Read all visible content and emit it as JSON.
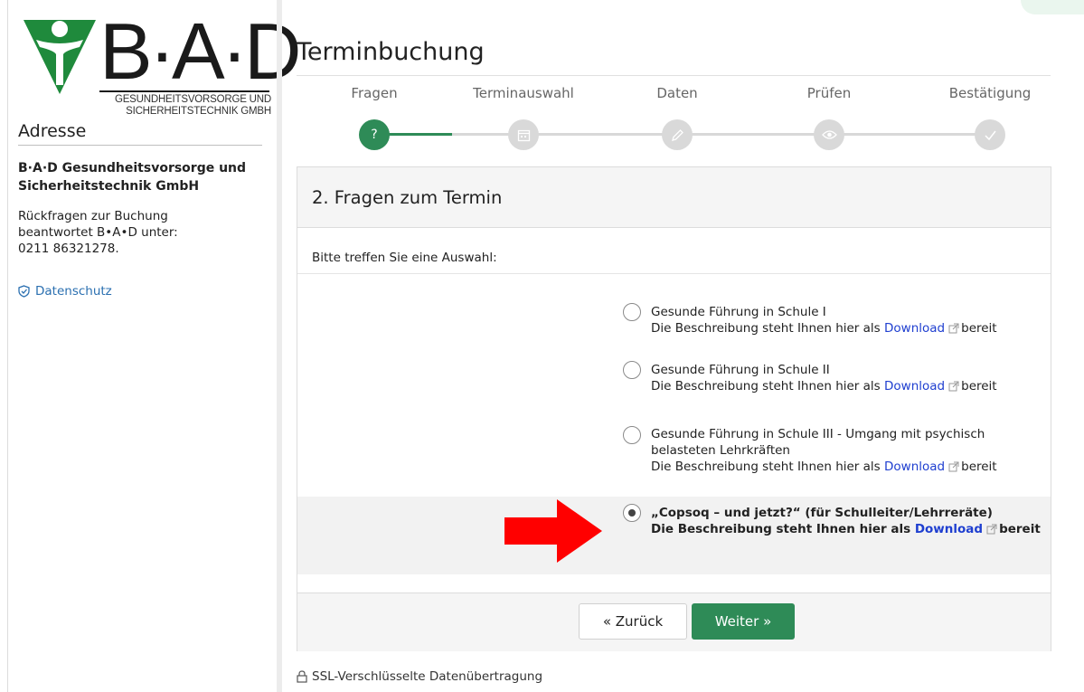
{
  "brand": {
    "logo_text": "B·A·D",
    "logo_sub_line1": "GESUNDHEITSVORSORGE UND",
    "logo_sub_line2": "SICHERHEITSTECHNIK GMBH",
    "green": "#2e8b57",
    "logo_green": "#1f8a3c"
  },
  "sidebar": {
    "heading": "Adresse",
    "company": "B·A·D Gesundheitsvorsorge und Sicherheitstechnik GmbH",
    "info_line1": "Rückfragen zur Buchung",
    "info_line2": "beantwortet B•A•D unter:",
    "info_line3": "0211 86321278.",
    "privacy_icon": "shield-check-icon",
    "privacy_label": "Datenschutz"
  },
  "main": {
    "title": "Terminbuchung",
    "steps": [
      {
        "label": "Fragen",
        "icon": "?",
        "active": true
      },
      {
        "label": "Terminauswahl",
        "icon": "calendar-icon",
        "active": false
      },
      {
        "label": "Daten",
        "icon": "pencil-icon",
        "active": false
      },
      {
        "label": "Prüfen",
        "icon": "eye-icon",
        "active": false
      },
      {
        "label": "Bestätigung",
        "icon": "check-icon",
        "active": false
      }
    ],
    "panel_title": "2. Fragen zum Termin",
    "prompt": "Bitte treffen Sie eine Auswahl:",
    "options": [
      {
        "title": "Gesunde Führung in Schule I",
        "desc_prefix": "Die Beschreibung steht Ihnen hier als",
        "link": "Download",
        "desc_suffix": "bereit",
        "selected": false
      },
      {
        "title": "Gesunde Führung in Schule II",
        "desc_prefix": "Die Beschreibung steht Ihnen hier als",
        "link": "Download",
        "desc_suffix": "bereit",
        "selected": false
      },
      {
        "title": "Gesunde Führung in Schule III - Umgang mit psychisch belasteten Lehrkräften",
        "desc_prefix": "Die Beschreibung steht Ihnen hier als",
        "link": "Download",
        "desc_suffix": "bereit",
        "selected": false
      },
      {
        "title": "„Copsoq – und jetzt?“ (für Schulleiter/Lehrreräte)",
        "desc_prefix": "Die Beschreibung steht Ihnen hier als",
        "link": "Download",
        "desc_suffix": "bereit",
        "selected": true
      }
    ],
    "back_label": "« Zurück",
    "next_label": "Weiter »",
    "ssl_icon": "lock-icon",
    "ssl_label": "SSL-Verschlüsselte Datenübertragung"
  },
  "annotation": {
    "arrow_color": "#ff0000",
    "arrow_icon": "red-arrow-right-icon"
  }
}
